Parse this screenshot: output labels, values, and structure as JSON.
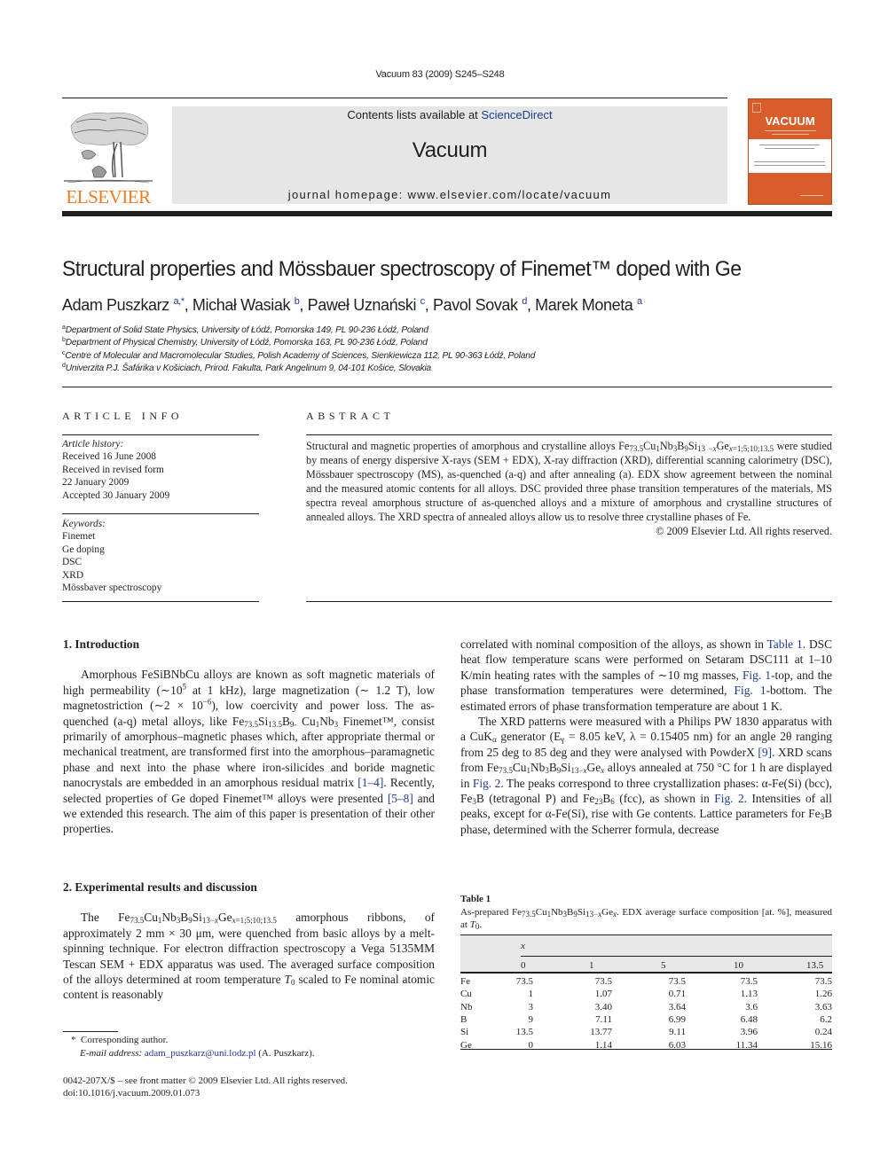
{
  "header": {
    "citation": "Vacuum 83 (2009) S245–S248",
    "contents_prefix": "Contents lists available at ",
    "contents_link": "ScienceDirect",
    "journal_name": "Vacuum",
    "homepage": "journal homepage: www.elsevier.com/locate/vacuum",
    "publisher_logo": "ELSEVIER",
    "cover_title": "VACUUM"
  },
  "colors": {
    "elsevier_orange": "#f07b22",
    "link_blue": "#1f3a8f",
    "cover_orange": "#d95d2a",
    "banner_gray": "#e6e6e6"
  },
  "article": {
    "title": "Structural properties and Mössbauer spectroscopy of Finemet™ doped with Ge",
    "authors": [
      {
        "name": "Adam Puszkarz",
        "sup": "a,*",
        "sep": ", "
      },
      {
        "name": "Michał Wasiak",
        "sup": "b",
        "sep": ", "
      },
      {
        "name": "Paweł Uznański",
        "sup": "c",
        "sep": ", "
      },
      {
        "name": "Pavol Sovak",
        "sup": "d",
        "sep": ", "
      },
      {
        "name": "Marek Moneta",
        "sup": "a",
        "sep": ""
      }
    ],
    "affiliations": [
      {
        "mark": "a",
        "text": "Department of Solid State Physics, University of Łódź, Pomorska 149, PL 90-236 Łódź, Poland"
      },
      {
        "mark": "b",
        "text": "Department of Physical Chemistry, University of Łódź, Pomorska 163, PL 90-236 Łódź, Poland"
      },
      {
        "mark": "c",
        "text": "Centre of Molecular and Macromolecular Studies, Polish Academy of Sciences, Sienkiewicza 112, PL 90-363 Łódź, Poland"
      },
      {
        "mark": "d",
        "text": "Univerzita P.J. Šafárika v Košiciach, Prirod. Fakulta, Park Angelinum 9, 04-101 Košice, Slovakia"
      }
    ]
  },
  "article_info": {
    "heading": "ARTICLE INFO",
    "history_label": "Article history:",
    "history": [
      "Received 16 June 2008",
      "Received in revised form",
      "22 January 2009",
      "Accepted 30 January 2009"
    ],
    "keywords_label": "Keywords:",
    "keywords": [
      "Finemet",
      "Ge doping",
      "DSC",
      "XRD",
      "Mössbaver spectroscopy"
    ]
  },
  "abstract": {
    "heading": "ABSTRACT",
    "p1a": "Structural and magnetic properties of amorphous and crystalline alloys Fe",
    "p1b": " were studied by means of energy dispersive X-rays (SEM + EDX), X-ray diffraction (XRD), differential scanning calorimetry (DSC), Mössbauer spectroscopy (MS), as-quenched (a-q) and after annealing (a). EDX show agreement between the nominal and the measured atomic contents for all alloys. DSC provided three phase transition temperatures of the materials, MS spectra reveal amorphous structure of as-quenched alloys and a mixture of amorphous and crystalline structures of annealed alloys. The XRD spectra of annealed alloys allow us to resolve three crystalline phases of Fe.",
    "copyright": "© 2009 Elsevier Ltd. All rights reserved."
  },
  "sections": {
    "intro_heading": "1.  Introduction",
    "intro_p1": "Amorphous FeSiBNbCu alloys are known as soft magnetic materials of high permeability (∼10",
    "intro_p2": " at 1 kHz), large magnetization (∼ 1.2 T), low magnetostriction (∼2 × 10",
    "intro_p3": "), low coercivity and power loss. The as-quenched (a-q) metal alloys, like Fe",
    "intro_p4": " Finemet™, consist primarily of amorphous–magnetic phases which, after appropriate thermal or mechanical treatment, are transformed first into the amorphous–paramagnetic phase and next into the phase where iron-silicides and boride magnetic nanocrystals are embedded in an amorphous residual matrix ",
    "intro_ref1": "[1–4]",
    "intro_p5": ". Recently, selected properties of Ge doped Finemet™ alloys were presented ",
    "intro_ref2": "[5–8]",
    "intro_p6": " and we extended this research. The aim of this paper is presentation of their other properties.",
    "exp_heading": "2.  Experimental results and discussion",
    "exp_p1": "The Fe",
    "exp_p2": " amorphous ribbons, of approximately 2 mm × 30 μm, were quenched from basic alloys by a melt-spinning technique. For electron diffraction spectroscopy a Vega 5135MM Tescan SEM + EDX apparatus was used. The averaged surface composition of the alloys determined at room temperature ",
    "exp_p3": " scaled to Fe nominal atomic content is reasonably",
    "right_p1": "correlated with nominal composition of the alloys, as shown in ",
    "right_ref_table": "Table 1",
    "right_p2": ". DSC heat flow temperature scans were performed on Setaram DSC111 at 1–10 K/min heating rates with the samples of ∼10 mg masses, ",
    "right_ref_fig1a": "Fig. 1",
    "right_p3": "-top, and the phase transformation temperatures were determined, ",
    "right_ref_fig1b": "Fig. 1",
    "right_p4": "-bottom. The estimated errors of phase transformation temperature are about 1 K.",
    "right_p5": "The XRD patterns were measured with a Philips PW 1830 apparatus with a CuK",
    "right_p6": " generator (E",
    "right_p7": " = 8.05 keV, λ = 0.15405 nm) for an angle 2θ ranging from 25 deg to 85 deg and they were analysed with PowderX ",
    "right_ref9": "[9]",
    "right_p8": ". XRD scans from Fe",
    "right_p9": " alloys annealed at 750 °C for 1 h are displayed in ",
    "right_ref_fig2a": "Fig. 2",
    "right_p10": ". The peaks correspond to three crystallization phases: α-Fe(Si) (bcc), Fe",
    "right_p11": "B (tetragonal P) and Fe",
    "right_p12": " (fcc), as shown in ",
    "right_ref_fig2b": "Fig. 2",
    "right_p13": ". Intensities of all peaks, except for α-Fe(Si), rise with Ge contents. Lattice parameters for Fe",
    "right_p14": "B phase, determined with the Scherrer formula, decrease"
  },
  "table1": {
    "label": "Table 1",
    "caption_a": "As-prepared Fe",
    "caption_b": ". EDX average surface composition [at. %], measured at ",
    "x_header": "x",
    "columns": [
      "0",
      "1",
      "5",
      "10",
      "13.5"
    ],
    "rows": [
      {
        "el": "Fe",
        "vals": [
          "73.5",
          "73.5",
          "73.5",
          "73.5",
          "73.5"
        ]
      },
      {
        "el": "Cu",
        "vals": [
          "1",
          "1.07",
          "0.71",
          "1.13",
          "1.26"
        ]
      },
      {
        "el": "Nb",
        "vals": [
          "3",
          "3.40",
          "3.64",
          "3.6",
          "3.63"
        ]
      },
      {
        "el": "B",
        "vals": [
          "9",
          "7.11",
          "6.99",
          "6.48",
          "6.2"
        ]
      },
      {
        "el": "Si",
        "vals": [
          "13.5",
          "13.77",
          "9.11",
          "3.96",
          "0.24"
        ]
      },
      {
        "el": "Ge",
        "vals": [
          "0",
          "1.14",
          "6.03",
          "11.34",
          "15.16"
        ]
      }
    ]
  },
  "footnotes": {
    "star": "*",
    "corresponding": "Corresponding author.",
    "email_label": "E-mail address:",
    "email": "adam_puszkarz@uni.lodz.pl",
    "email_owner": " (A. Puszkarz).",
    "issn": "0042-207X/$ – see front matter © 2009 Elsevier Ltd. All rights reserved.",
    "doi": "doi:10.1016/j.vacuum.2009.01.073"
  }
}
